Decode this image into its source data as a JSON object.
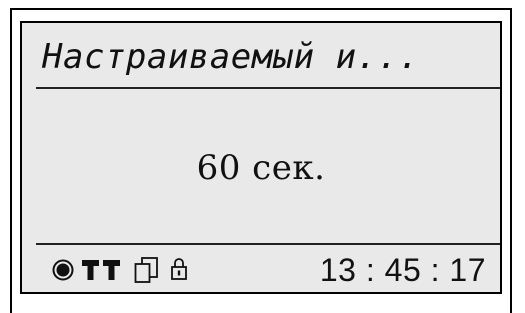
{
  "screen": {
    "title": "Настраиваемый и...",
    "value": "60 сек."
  },
  "status_bar": {
    "icons": [
      "record-icon",
      "key-icon",
      "key-icon",
      "copy-icon",
      "lock-icon"
    ],
    "clock": "13 : 45 : 17"
  },
  "colors": {
    "lcd_background": "#e9e9e9",
    "foreground": "#111111",
    "frame": "#000000"
  }
}
